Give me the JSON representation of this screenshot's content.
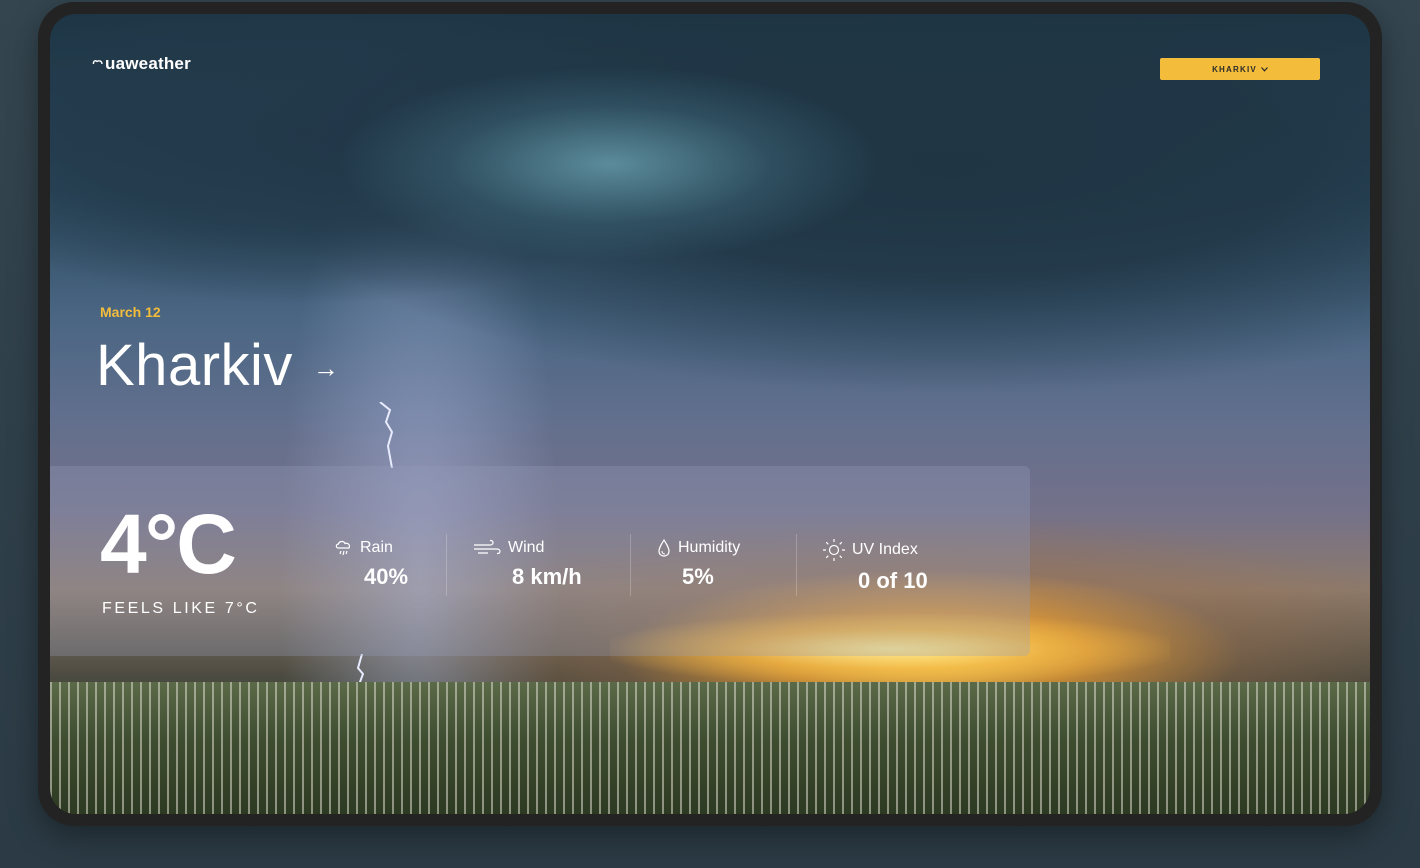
{
  "app": {
    "logo_text": "uaweather"
  },
  "header": {
    "city_select_label": "KHARKIV"
  },
  "hero": {
    "date": "March 12",
    "city": "Kharkiv",
    "arrow": "→"
  },
  "current": {
    "temperature": "4°C",
    "feels_like": "FEELS LIKE 7°C",
    "metrics": [
      {
        "icon": "rain-icon",
        "label": "Rain",
        "value": "40%"
      },
      {
        "icon": "wind-icon",
        "label": "Wind",
        "value": "8 km/h"
      },
      {
        "icon": "humidity-icon",
        "label": "Humidity",
        "value": "5%"
      },
      {
        "icon": "sun-icon",
        "label": "UV Index",
        "value": "0 of 10"
      }
    ]
  },
  "colors": {
    "accent": "#f3bd3b",
    "frame": "#232323",
    "page_bg": "#2f3f4a"
  }
}
